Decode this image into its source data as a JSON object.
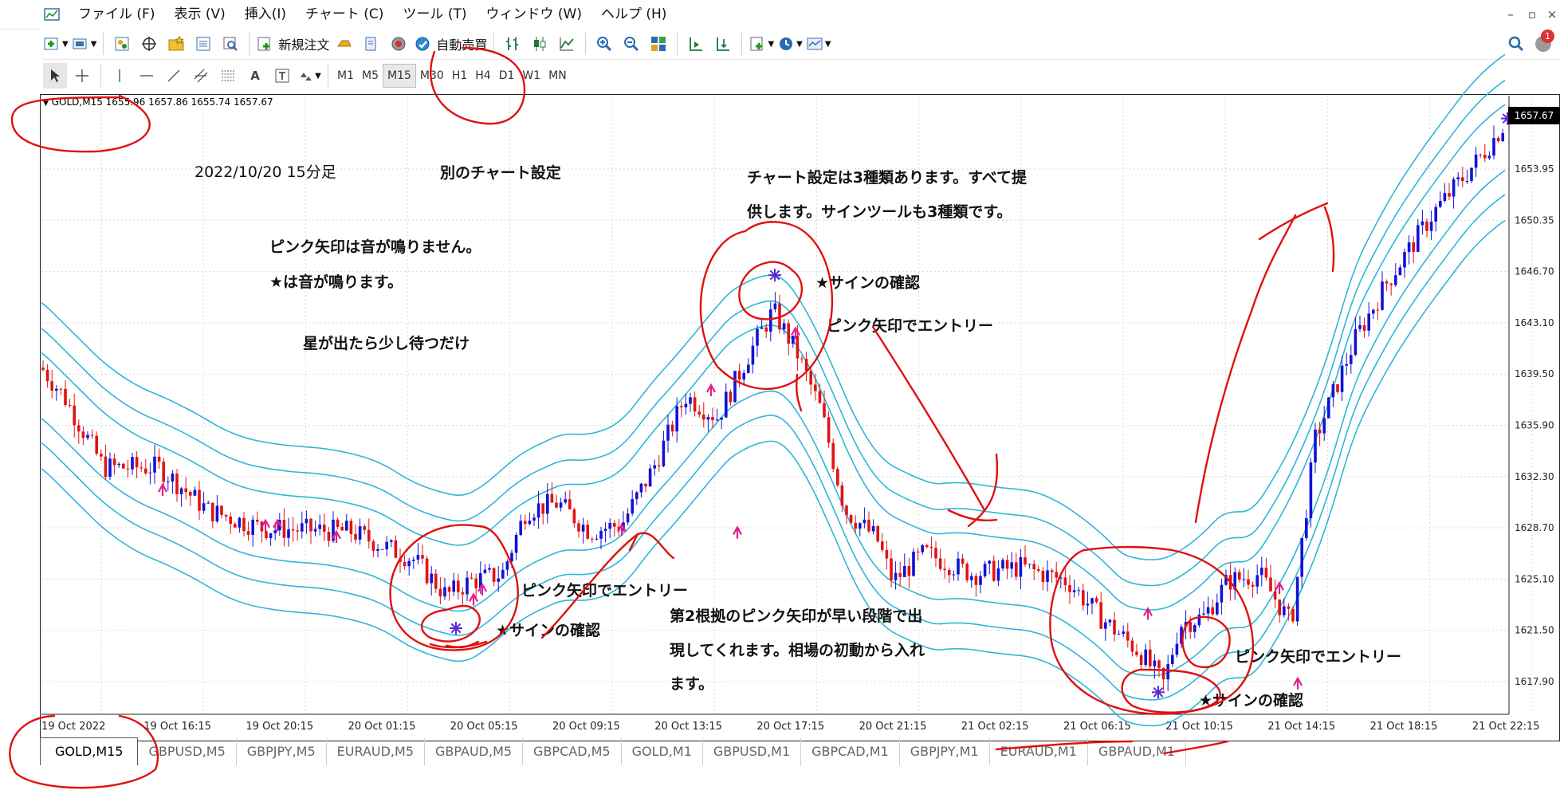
{
  "menu": [
    "ファイル (F)",
    "表示 (V)",
    "挿入(I)",
    "チャート (C)",
    "ツール (T)",
    "ウィンドウ (W)",
    "ヘルプ (H)"
  ],
  "toolbar": {
    "new_order": "新規注文",
    "auto_trade": "自動売買"
  },
  "timeframes": [
    "M1",
    "M5",
    "M15",
    "M30",
    "H1",
    "H4",
    "D1",
    "W1",
    "MN"
  ],
  "active_timeframe": "M15",
  "notification_count": "1",
  "chart": {
    "symbol_header": "GOLD,M15  1655.96 1657.86 1655.74 1657.67",
    "current_price": "1657.67",
    "price_ticks": [
      "1653.95",
      "1650.35",
      "1646.70",
      "1643.10",
      "1639.50",
      "1635.90",
      "1632.30",
      "1628.70",
      "1625.10",
      "1621.50",
      "1617.90"
    ],
    "time_ticks": [
      "19 Oct 2022",
      "19 Oct 16:15",
      "19 Oct 20:15",
      "20 Oct 01:15",
      "20 Oct 05:15",
      "20 Oct 09:15",
      "20 Oct 13:15",
      "20 Oct 17:15",
      "20 Oct 21:15",
      "21 Oct 02:15",
      "21 Oct 06:15",
      "21 Oct 10:15",
      "21 Oct 14:15",
      "21 Oct 18:15",
      "21 Oct 22:15"
    ],
    "colors": {
      "bull": "#1212d6",
      "bear": "#e01414",
      "bands": "#2fb6d8",
      "pink_arrow": "#e0208c",
      "ink": "#e01010"
    }
  },
  "annotations": {
    "date_label": "2022/10/20 15分足",
    "other_setting": "別のチャート設定",
    "settings_note_1": "チャート設定は3種類あります。すべて提",
    "settings_note_2": "供します。サインツールも3種類です。",
    "pink_no_sound": "ピンク矢印は音が鳴りません。",
    "star_sound": "★は音が鳴ります。",
    "wait_note": "星が出たら少し待つだけ",
    "sign_confirm_1": "★サインの確認",
    "pink_entry_1": "ピンク矢印でエントリー",
    "pink_entry_2": "ピンク矢印でエントリー",
    "sign_confirm_2": "★サインの確認",
    "second_basis_1": "第2根拠のピンク矢印が早い段階で出",
    "second_basis_2": "現してくれます。相場の初動から入れ",
    "second_basis_3": "ます。",
    "pink_entry_3": "ピンク矢印でエントリー",
    "sign_confirm_3": "★サインの確認"
  },
  "tabs": [
    "GOLD,M15",
    "GBPUSD,M5",
    "GBPJPY,M5",
    "EURAUD,M5",
    "GBPAUD,M5",
    "GBPCAD,M5",
    "GOLD,M1",
    "GBPUSD,M1",
    "GBPCAD,M1",
    "GBPJPY,M1",
    "EURAUD,M1",
    "GBPAUD,M1"
  ],
  "active_tab": "GOLD,M15"
}
